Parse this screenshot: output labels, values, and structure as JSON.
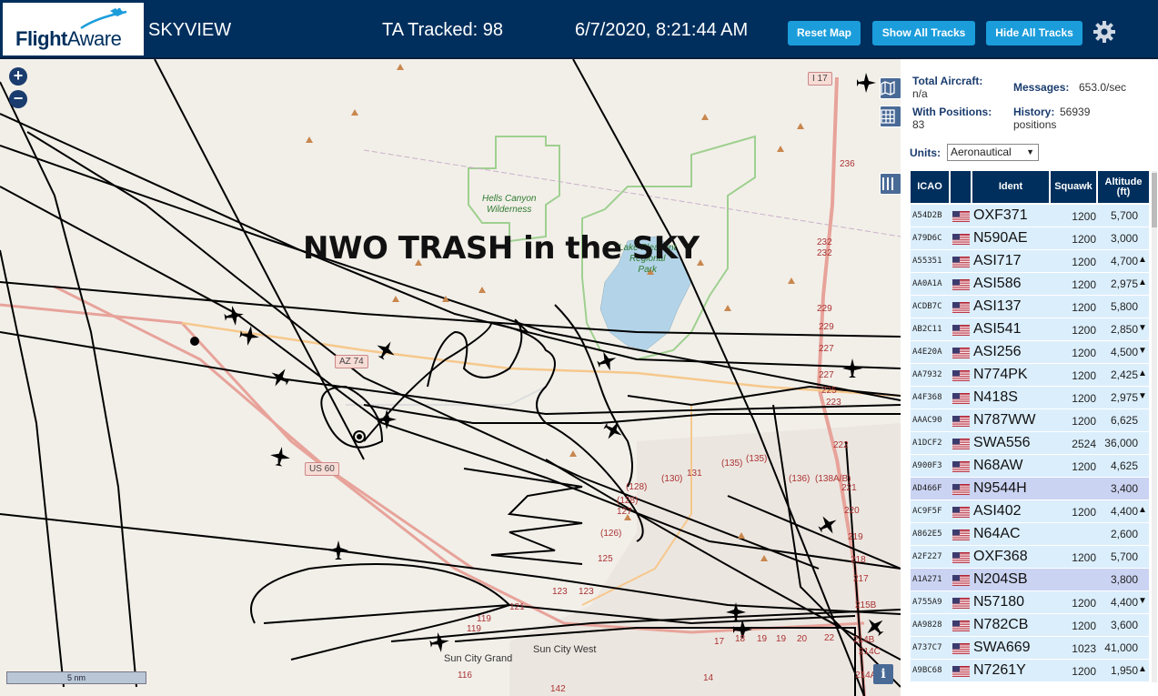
{
  "header": {
    "logo_flight": "Flight",
    "logo_aware": "Aware",
    "app_title": "SKYVIEW",
    "tracked": "TA Tracked: 98",
    "clock": "6/7/2020, 8:21:44 AM",
    "btn_reset": "Reset Map",
    "btn_show": "Show All Tracks",
    "btn_hide": "Hide All Tracks"
  },
  "map": {
    "overlay_text": "NWO TRASH in the SKY",
    "zoom_in": "+",
    "zoom_out": "−",
    "scale": "5 nm",
    "info": "i",
    "labels": {
      "hells_canyon": "Hells Canyon",
      "wilderness": "Wilderness",
      "lake_pleasant": "Lake Pleasant",
      "regional": "Regional",
      "park": "Park",
      "az74": "AZ 74",
      "us60": "US 60",
      "i17": "I 17",
      "sun_city_grand": "Sun City Grand",
      "sun_city_west": "Sun City West",
      "n236": "236",
      "n232a": "232",
      "n232b": "232",
      "n229a": "229",
      "n229b": "229",
      "n227a": "227",
      "n227b": "227",
      "n225": "225",
      "n223": "223",
      "n222": "222",
      "n221": "221",
      "n220": "220",
      "n219": "219",
      "n218": "218",
      "n217": "217",
      "n215b": "215B",
      "n214b": "214B",
      "n214c": "214C",
      "n214a": "214A",
      "n135a": "(135)",
      "n135b": "(135)",
      "n136": "(136)",
      "n138": "(138A/B)",
      "n131": "131",
      "n130": "(130)",
      "n128a": "(128)",
      "n128b": "(128)",
      "n127": "127",
      "n126": "(126)",
      "n125": "125",
      "n123a": "123",
      "n123b": "123",
      "n121": "121",
      "n119a": "119",
      "n119b": "119",
      "n116": "116",
      "n142": "142",
      "n17": "17",
      "n18": "18",
      "n19a": "19",
      "n19b": "19",
      "n20": "20",
      "n22": "22",
      "n14": "14"
    }
  },
  "panel": {
    "total_label": "Total Aircraft:",
    "total_value": "n/a",
    "withpos_label": "With Positions:",
    "withpos_value": "83",
    "messages_label": "Messages:",
    "messages_value": "653.0/sec",
    "history_label": "History:",
    "history_value": "56939",
    "history_unit": "positions",
    "units_label": "Units:",
    "units_value": "Aeronautical",
    "columns": {
      "icao": "ICAO",
      "ident": "Ident",
      "squawk": "Squawk",
      "altitude": "Altitude",
      "altitude_unit": "(ft)"
    },
    "rows": [
      {
        "icao": "A54D2B",
        "ident": "OXF371",
        "squawk": "1200",
        "altitude": "5,700",
        "trend": ""
      },
      {
        "icao": "A79D6C",
        "ident": "N590AE",
        "squawk": "1200",
        "altitude": "3,000",
        "trend": ""
      },
      {
        "icao": "A55351",
        "ident": "ASI717",
        "squawk": "1200",
        "altitude": "4,700",
        "trend": "▲"
      },
      {
        "icao": "AA0A1A",
        "ident": "ASI586",
        "squawk": "1200",
        "altitude": "2,975",
        "trend": "▲"
      },
      {
        "icao": "ACDB7C",
        "ident": "ASI137",
        "squawk": "1200",
        "altitude": "5,800",
        "trend": ""
      },
      {
        "icao": "AB2C11",
        "ident": "ASI541",
        "squawk": "1200",
        "altitude": "2,850",
        "trend": "▼"
      },
      {
        "icao": "A4E20A",
        "ident": "ASI256",
        "squawk": "1200",
        "altitude": "4,500",
        "trend": "▼"
      },
      {
        "icao": "AA7932",
        "ident": "N774PK",
        "squawk": "1200",
        "altitude": "2,425",
        "trend": "▲"
      },
      {
        "icao": "A4F368",
        "ident": "N418S",
        "squawk": "1200",
        "altitude": "2,975",
        "trend": "▼"
      },
      {
        "icao": "AAAC90",
        "ident": "N787WW",
        "squawk": "1200",
        "altitude": "6,625",
        "trend": ""
      },
      {
        "icao": "A1DCF2",
        "ident": "SWA556",
        "squawk": "2524",
        "altitude": "36,000",
        "trend": ""
      },
      {
        "icao": "A900F3",
        "ident": "N68AW",
        "squawk": "1200",
        "altitude": "4,625",
        "trend": ""
      },
      {
        "icao": "AD466F",
        "ident": "N9544H",
        "squawk": "",
        "altitude": "3,400",
        "trend": "",
        "sel": true
      },
      {
        "icao": "AC9F5F",
        "ident": "ASI402",
        "squawk": "1200",
        "altitude": "4,400",
        "trend": "▲"
      },
      {
        "icao": "A862E5",
        "ident": "N64AC",
        "squawk": "",
        "altitude": "2,600",
        "trend": ""
      },
      {
        "icao": "A2F227",
        "ident": "OXF368",
        "squawk": "1200",
        "altitude": "5,700",
        "trend": ""
      },
      {
        "icao": "A1A271",
        "ident": "N204SB",
        "squawk": "",
        "altitude": "3,800",
        "trend": "",
        "sel": true
      },
      {
        "icao": "A755A9",
        "ident": "N57180",
        "squawk": "1200",
        "altitude": "4,400",
        "trend": "▼"
      },
      {
        "icao": "AA9828",
        "ident": "N782CB",
        "squawk": "1200",
        "altitude": "3,600",
        "trend": ""
      },
      {
        "icao": "A737C7",
        "ident": "SWA669",
        "squawk": "1023",
        "altitude": "41,000",
        "trend": ""
      },
      {
        "icao": "A9BC68",
        "ident": "N7261Y",
        "squawk": "1200",
        "altitude": "1,950",
        "trend": "▲"
      }
    ]
  },
  "colors": {
    "header_bg": "#002f5d",
    "button": "#1b9ddb",
    "row_bg": "#dbeefc",
    "row_selected": "#cbd3f2",
    "track": "#000000",
    "lake": "#b3d4e8",
    "park_border": "#9fd08f"
  },
  "icons": [
    "flightaware-plane-logo",
    "gear-icon",
    "zoom-in-icon",
    "zoom-out-icon",
    "map-layer-icon",
    "grid-icon",
    "columns-icon",
    "info-icon",
    "us-flag-icon",
    "aircraft-icon"
  ]
}
